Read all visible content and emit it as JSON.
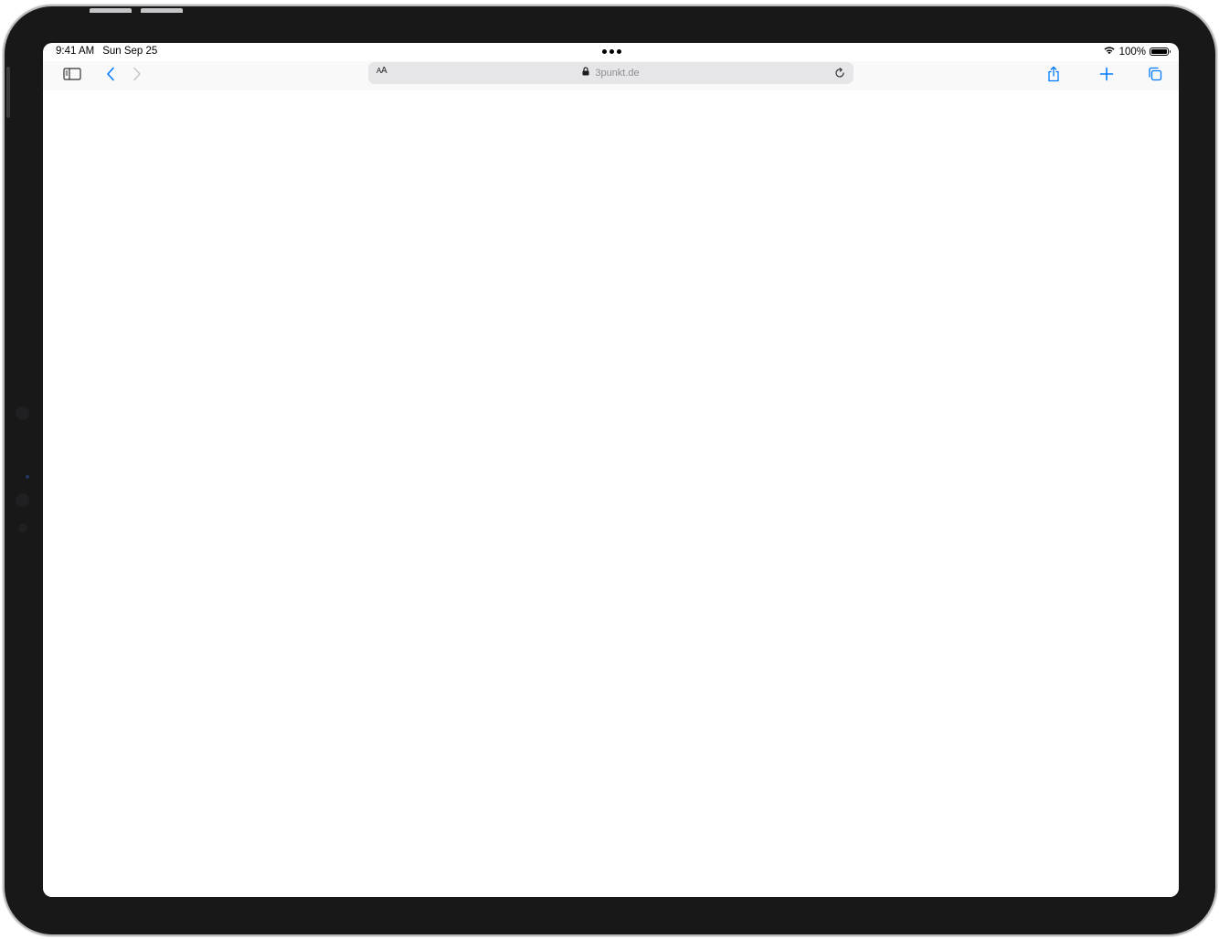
{
  "status_bar": {
    "time": "9:41 AM",
    "date": "Sun Sep 25",
    "battery_percent": "100%",
    "battery_level": 1.0
  },
  "toolbar": {
    "text_size_label_small": "A",
    "text_size_label_large": "A",
    "url": "3punkt.de"
  },
  "icons": {
    "sidebar": "sidebar-icon",
    "back": "chevron-left-icon",
    "forward": "chevron-right-icon",
    "lock": "lock-icon",
    "reload": "reload-icon",
    "share": "share-icon",
    "new_tab": "plus-icon",
    "tabs": "tabs-overview-icon",
    "wifi": "wifi-icon",
    "battery": "battery-icon"
  },
  "colors": {
    "accent": "#007aff",
    "accent_disabled": "#c7c7cc",
    "device_frame": "#181818"
  }
}
